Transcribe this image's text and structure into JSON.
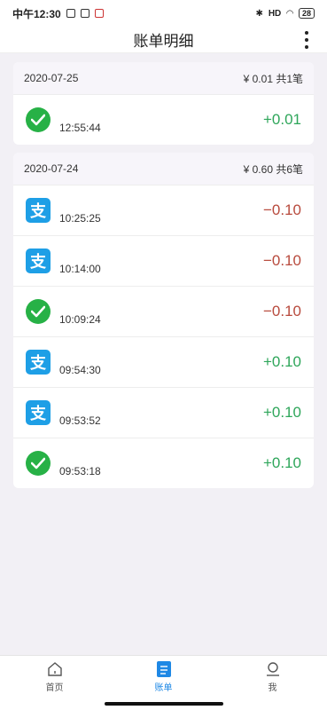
{
  "status": {
    "time": "中午12:30",
    "network": "HD",
    "battery": "28"
  },
  "header": {
    "title": "账单明细"
  },
  "groups": [
    {
      "date": "2020-07-25",
      "summary": "¥ 0.01  共1笔",
      "items": [
        {
          "type": "wechat",
          "name": "",
          "time": "12:55:44",
          "amount": "+0.01",
          "sign": "pos"
        }
      ]
    },
    {
      "date": "2020-07-24",
      "summary": "¥ 0.60  共6笔",
      "items": [
        {
          "type": "alipay",
          "name": "",
          "time": "10:25:25",
          "amount": "−0.10",
          "sign": "neg"
        },
        {
          "type": "alipay",
          "name": "",
          "time": "10:14:00",
          "amount": "−0.10",
          "sign": "neg"
        },
        {
          "type": "wechat",
          "name": "",
          "time": "10:09:24",
          "amount": "−0.10",
          "sign": "neg"
        },
        {
          "type": "alipay",
          "name": "",
          "time": "09:54:30",
          "amount": "+0.10",
          "sign": "pos"
        },
        {
          "type": "alipay",
          "name": "",
          "time": "09:53:52",
          "amount": "+0.10",
          "sign": "pos"
        },
        {
          "type": "wechat",
          "name": "",
          "time": "09:53:18",
          "amount": "+0.10",
          "sign": "pos"
        }
      ]
    }
  ],
  "icons": {
    "alipay_glyph": "支"
  },
  "tabs": [
    {
      "label": "首页",
      "icon": "home-icon",
      "active": false
    },
    {
      "label": "账单",
      "icon": "bill-icon",
      "active": true
    },
    {
      "label": "我",
      "icon": "profile-icon",
      "active": false
    }
  ]
}
